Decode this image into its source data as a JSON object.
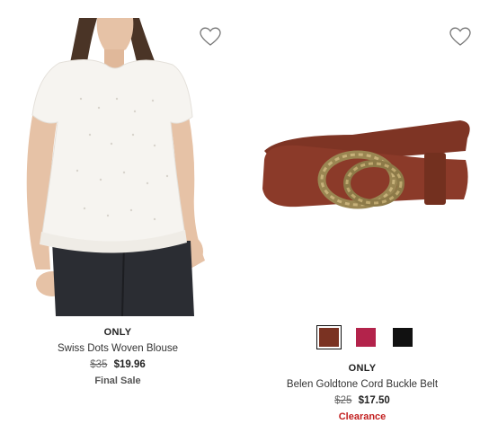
{
  "products": [
    {
      "brand": "ONLY",
      "name": "Swiss Dots Woven Blouse",
      "was_price": "$35",
      "price": "$19.96",
      "note": "Final Sale",
      "favorite_icon": "heart-outline-icon"
    },
    {
      "brand": "ONLY",
      "name": "Belen Goldtone Cord Buckle Belt",
      "was_price": "$25",
      "price": "$17.50",
      "note": "Clearance",
      "note_color": "#c21f1f",
      "favorite_icon": "heart-outline-icon",
      "swatches": [
        {
          "color": "#7a3222",
          "selected": true
        },
        {
          "color": "#b3234b",
          "selected": false
        },
        {
          "color": "#111111",
          "selected": false
        }
      ]
    }
  ]
}
